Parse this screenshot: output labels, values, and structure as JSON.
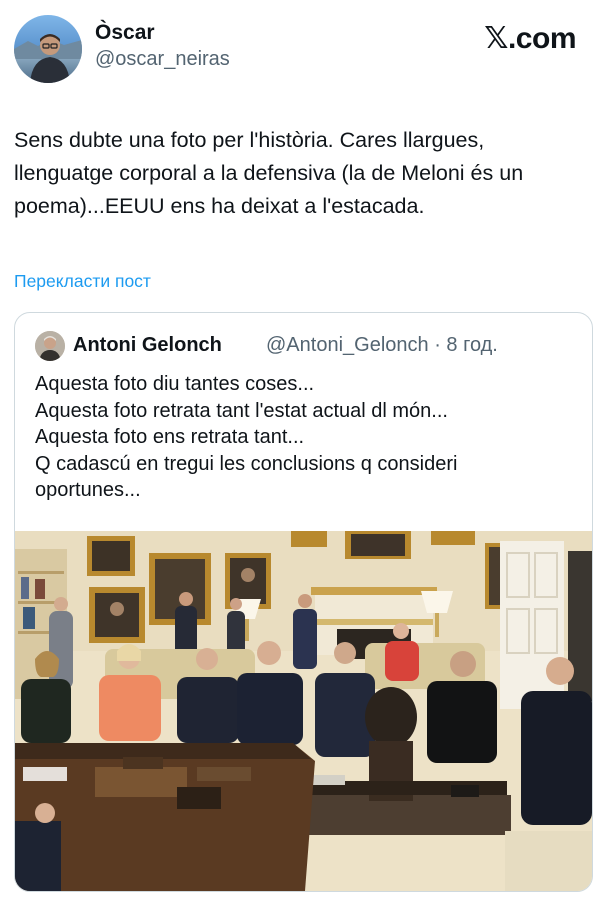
{
  "post": {
    "author": {
      "display_name": "Òscar",
      "handle": "@oscar_neiras",
      "avatar": "profile-photo-man-with-glasses"
    },
    "brand": {
      "glyph": "𝕏",
      "suffix": ".com"
    },
    "text": "Sens dubte una foto per l'història. Cares llargues, llenguatge corporal a la defensiva (la de Meloni és un poema)...EEUU ens ha deixat a l'estacada.",
    "translate_label": "Перекласти пост"
  },
  "quote": {
    "author": {
      "display_name": "Antoni Gelonch",
      "handle": "@Antoni_Gelonch",
      "time": "· 8 год.",
      "avatar": "profile-photo-older-man"
    },
    "lines": [
      "Aquesta foto diu tantes coses...",
      "Aquesta foto retrata tant l'estat actual dl món...",
      "Aquesta foto ens retrata tant...",
      "Q cadascú en tregui les conclusions q consideri",
      "oportunes..."
    ],
    "photo": {
      "description_icon": "oval-office-meeting-photo"
    }
  },
  "colors": {
    "text": "#0f1419",
    "secondary": "#536471",
    "link": "#1d9bf0",
    "border": "#cfd9de"
  }
}
